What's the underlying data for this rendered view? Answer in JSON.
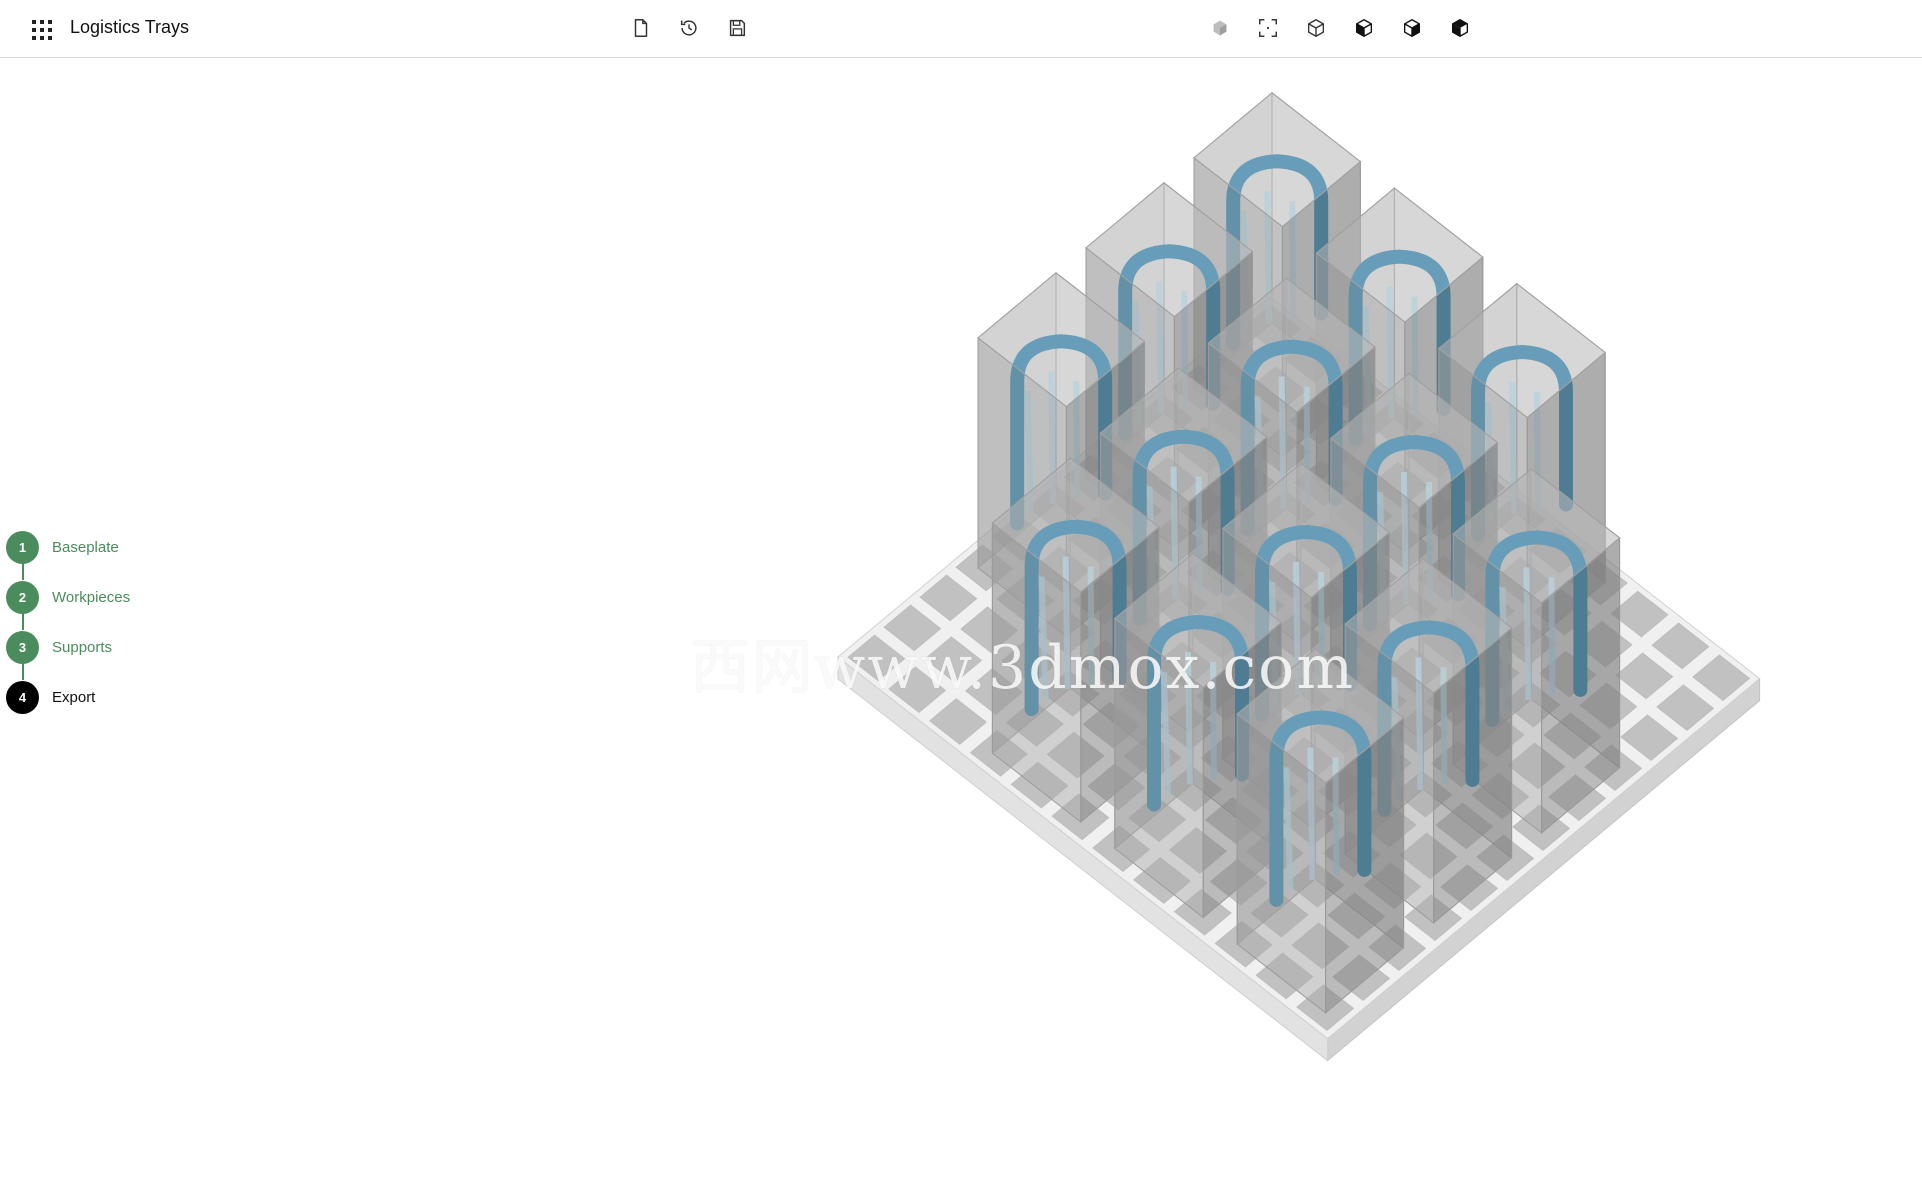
{
  "app": {
    "title": "Logistics Trays",
    "apps_icon": "grid-apps-icon"
  },
  "toolbar": {
    "file_actions": [
      {
        "name": "new-file-button",
        "icon": "file-icon"
      },
      {
        "name": "history-button",
        "icon": "history-icon"
      },
      {
        "name": "save-button",
        "icon": "save-icon"
      }
    ],
    "view_actions": [
      {
        "name": "shaded-view-button",
        "icon": "shaded-cube-icon"
      },
      {
        "name": "fit-view-button",
        "icon": "fit-to-screen-icon"
      },
      {
        "name": "iso-view-button",
        "icon": "cube-outline-icon"
      },
      {
        "name": "left-view-button",
        "icon": "cube-left-face-icon"
      },
      {
        "name": "right-view-button",
        "icon": "cube-right-face-icon"
      },
      {
        "name": "top-view-button",
        "icon": "cube-top-face-icon"
      }
    ]
  },
  "steps": [
    {
      "number": "1",
      "label": "Baseplate",
      "status": "done"
    },
    {
      "number": "2",
      "label": "Workpieces",
      "status": "done"
    },
    {
      "number": "3",
      "label": "Supports",
      "status": "done"
    },
    {
      "number": "4",
      "label": "Export",
      "status": "active"
    }
  ],
  "colors": {
    "step_done": "#4a8c5c",
    "step_active": "#000000",
    "workpiece": "#2b7fa8",
    "tray": "#f0f0f0",
    "support_box": "#8c8c8c"
  },
  "viewport": {
    "watermark": "西网www.3dmox.com"
  }
}
